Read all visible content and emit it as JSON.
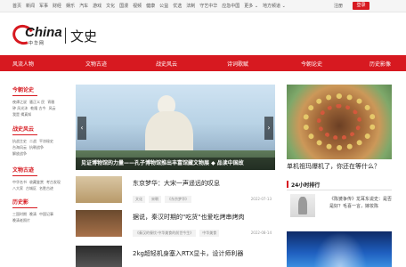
{
  "topbar": {
    "nav": [
      "首页",
      "新闻",
      "军事",
      "财经",
      "娱乐",
      "汽车",
      "游戏",
      "文化",
      "国漫",
      "视频",
      "健康",
      "公益",
      "优选",
      "法制",
      "守艺中华",
      "应急中国",
      "更多 ⌄",
      "地方频道 ⌄"
    ],
    "register": "注册",
    "login": "登录"
  },
  "logo": {
    "brand": "China",
    "brand_cn": "中华网",
    "section": "文史"
  },
  "main_nav": [
    "风流人物",
    "文物古迹",
    "战史风云",
    "诗词歌赋",
    "今朝论史",
    "历史影像"
  ],
  "sidebar": [
    {
      "title": "今朝论史",
      "links": [
        "夜谭之说",
        "骚正义 民",
        "宵雅",
        "钟 风光沐",
        "乾隆 古今",
        "风云",
        "我是 揭真知"
      ]
    },
    {
      "title": "战史风云",
      "links": [
        "抗战主史",
        "二战",
        "平凉秘史",
        "台海风云",
        "抗朝战争",
        "解放战争"
      ]
    },
    {
      "title": "文物古迹",
      "links": [
        "中华名书",
        "收藏鉴赏",
        "考古发现",
        "八大家",
        "古城区",
        "名胜古迹"
      ]
    },
    {
      "title": "历史影",
      "links": [
        "三国时期",
        "晚清",
        "中国记事",
        "晚清老照片"
      ]
    }
  ],
  "hero": {
    "caption": "见证博物馆的力量——孔子博物馆推出丰富馆藏文物展 ◆ 品读中国故"
  },
  "news": [
    {
      "title": "东京梦华：大宋一声遥远的叹息",
      "tags": [
        "文化",
        "宋朝",
        "《东京梦华》"
      ],
      "date": "2022-07-13"
    },
    {
      "title": "据说，秦汉时期的\"吃货\"也爱吃烤串烤肉",
      "tags": [
        "《秦汉的餐饮·中华美食的前世今生》",
        "中华美食"
      ],
      "date": "2022-08-14"
    },
    {
      "title": "2kg超轻机身塞入RTX显卡，设计师利器",
      "tags": [],
      "date": ""
    }
  ],
  "right": {
    "caption": "单机祖玛爆机了，你还在等什么？",
    "rank_title": "24小时排行",
    "rank_item": "《陈婆争传》龙耳东说史：是否是好？毛喜一言，嫁妆陈"
  },
  "colors": {
    "accent": "#d71920"
  }
}
